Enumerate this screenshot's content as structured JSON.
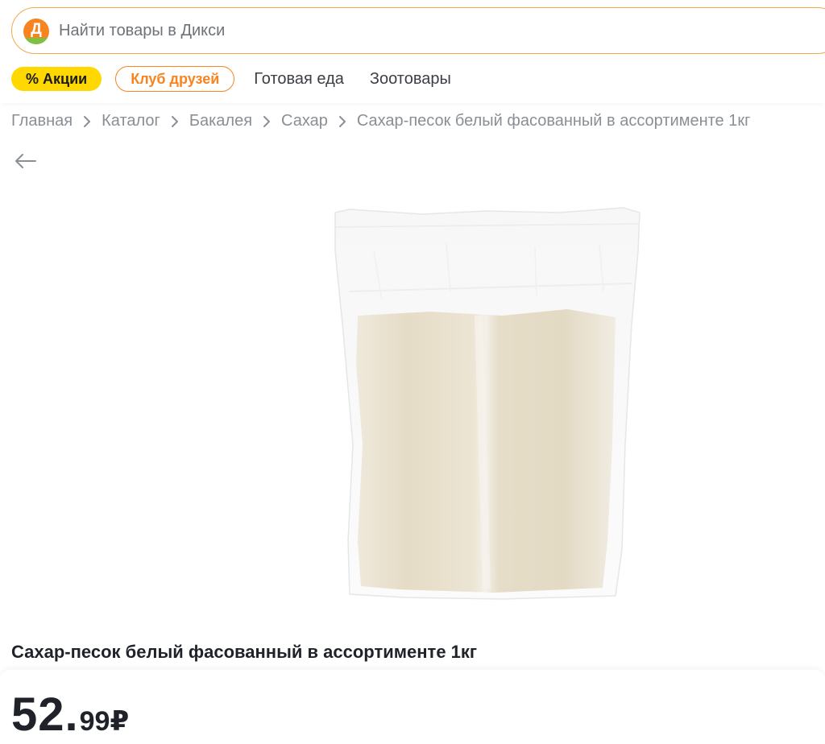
{
  "search": {
    "logo_letter": "Д",
    "placeholder": "Найти товары в Дикси"
  },
  "nav": {
    "promo_label": "% Акции",
    "club_label": "Клуб друзей",
    "links": [
      "Готовая еда",
      "Зоотовары"
    ]
  },
  "breadcrumb": [
    "Главная",
    "Каталог",
    "Бакалея",
    "Сахар",
    "Сахар-песок белый фасованный в ассортименте 1кг"
  ],
  "product": {
    "title": "Сахар-песок белый фасованный в ассортименте 1кг",
    "price_integer": "52",
    "price_separator": ".",
    "price_fraction": "99",
    "currency": "₽"
  },
  "icons": {
    "back": "arrow-left-icon",
    "chevron": "chevron-right-icon"
  },
  "colors": {
    "brand_orange": "#f7841e",
    "promo_yellow": "#ffd800",
    "logo_green": "#7cc242"
  }
}
